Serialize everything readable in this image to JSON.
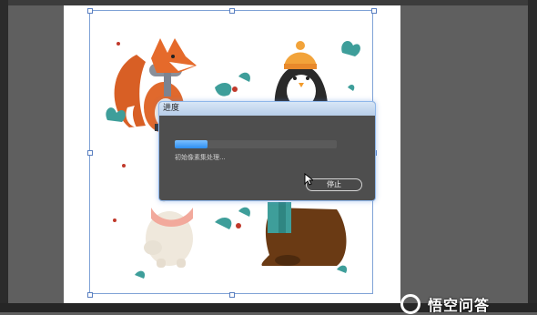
{
  "dialog": {
    "title": "进度",
    "status_text": "初始像素集处理...",
    "stop_label": "停止",
    "progress": 0.2
  },
  "watermark": {
    "text": "悟空问答",
    "icon": "wukong-logo-icon"
  },
  "colors": {
    "progress_fill": "#3b9bf5",
    "selection_border": "#7fa2d6",
    "dialog_bg": "#4e4e4e"
  }
}
